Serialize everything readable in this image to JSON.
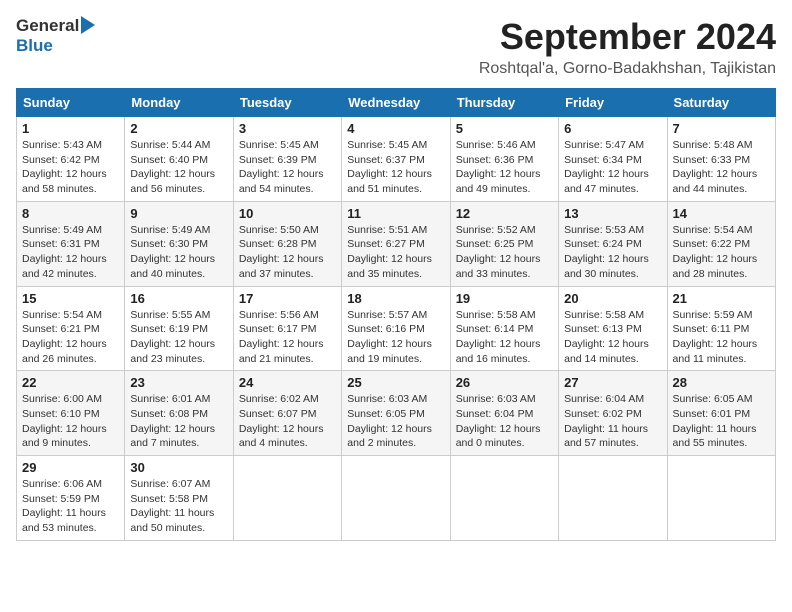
{
  "header": {
    "logo_general": "General",
    "logo_blue": "Blue",
    "month_title": "September 2024",
    "location": "Roshtqal'a, Gorno-Badakhshan, Tajikistan"
  },
  "days_of_week": [
    "Sunday",
    "Monday",
    "Tuesday",
    "Wednesday",
    "Thursday",
    "Friday",
    "Saturday"
  ],
  "weeks": [
    [
      {
        "day": "1",
        "sunrise": "Sunrise: 5:43 AM",
        "sunset": "Sunset: 6:42 PM",
        "daylight": "Daylight: 12 hours and 58 minutes."
      },
      {
        "day": "2",
        "sunrise": "Sunrise: 5:44 AM",
        "sunset": "Sunset: 6:40 PM",
        "daylight": "Daylight: 12 hours and 56 minutes."
      },
      {
        "day": "3",
        "sunrise": "Sunrise: 5:45 AM",
        "sunset": "Sunset: 6:39 PM",
        "daylight": "Daylight: 12 hours and 54 minutes."
      },
      {
        "day": "4",
        "sunrise": "Sunrise: 5:45 AM",
        "sunset": "Sunset: 6:37 PM",
        "daylight": "Daylight: 12 hours and 51 minutes."
      },
      {
        "day": "5",
        "sunrise": "Sunrise: 5:46 AM",
        "sunset": "Sunset: 6:36 PM",
        "daylight": "Daylight: 12 hours and 49 minutes."
      },
      {
        "day": "6",
        "sunrise": "Sunrise: 5:47 AM",
        "sunset": "Sunset: 6:34 PM",
        "daylight": "Daylight: 12 hours and 47 minutes."
      },
      {
        "day": "7",
        "sunrise": "Sunrise: 5:48 AM",
        "sunset": "Sunset: 6:33 PM",
        "daylight": "Daylight: 12 hours and 44 minutes."
      }
    ],
    [
      {
        "day": "8",
        "sunrise": "Sunrise: 5:49 AM",
        "sunset": "Sunset: 6:31 PM",
        "daylight": "Daylight: 12 hours and 42 minutes."
      },
      {
        "day": "9",
        "sunrise": "Sunrise: 5:49 AM",
        "sunset": "Sunset: 6:30 PM",
        "daylight": "Daylight: 12 hours and 40 minutes."
      },
      {
        "day": "10",
        "sunrise": "Sunrise: 5:50 AM",
        "sunset": "Sunset: 6:28 PM",
        "daylight": "Daylight: 12 hours and 37 minutes."
      },
      {
        "day": "11",
        "sunrise": "Sunrise: 5:51 AM",
        "sunset": "Sunset: 6:27 PM",
        "daylight": "Daylight: 12 hours and 35 minutes."
      },
      {
        "day": "12",
        "sunrise": "Sunrise: 5:52 AM",
        "sunset": "Sunset: 6:25 PM",
        "daylight": "Daylight: 12 hours and 33 minutes."
      },
      {
        "day": "13",
        "sunrise": "Sunrise: 5:53 AM",
        "sunset": "Sunset: 6:24 PM",
        "daylight": "Daylight: 12 hours and 30 minutes."
      },
      {
        "day": "14",
        "sunrise": "Sunrise: 5:54 AM",
        "sunset": "Sunset: 6:22 PM",
        "daylight": "Daylight: 12 hours and 28 minutes."
      }
    ],
    [
      {
        "day": "15",
        "sunrise": "Sunrise: 5:54 AM",
        "sunset": "Sunset: 6:21 PM",
        "daylight": "Daylight: 12 hours and 26 minutes."
      },
      {
        "day": "16",
        "sunrise": "Sunrise: 5:55 AM",
        "sunset": "Sunset: 6:19 PM",
        "daylight": "Daylight: 12 hours and 23 minutes."
      },
      {
        "day": "17",
        "sunrise": "Sunrise: 5:56 AM",
        "sunset": "Sunset: 6:17 PM",
        "daylight": "Daylight: 12 hours and 21 minutes."
      },
      {
        "day": "18",
        "sunrise": "Sunrise: 5:57 AM",
        "sunset": "Sunset: 6:16 PM",
        "daylight": "Daylight: 12 hours and 19 minutes."
      },
      {
        "day": "19",
        "sunrise": "Sunrise: 5:58 AM",
        "sunset": "Sunset: 6:14 PM",
        "daylight": "Daylight: 12 hours and 16 minutes."
      },
      {
        "day": "20",
        "sunrise": "Sunrise: 5:58 AM",
        "sunset": "Sunset: 6:13 PM",
        "daylight": "Daylight: 12 hours and 14 minutes."
      },
      {
        "day": "21",
        "sunrise": "Sunrise: 5:59 AM",
        "sunset": "Sunset: 6:11 PM",
        "daylight": "Daylight: 12 hours and 11 minutes."
      }
    ],
    [
      {
        "day": "22",
        "sunrise": "Sunrise: 6:00 AM",
        "sunset": "Sunset: 6:10 PM",
        "daylight": "Daylight: 12 hours and 9 minutes."
      },
      {
        "day": "23",
        "sunrise": "Sunrise: 6:01 AM",
        "sunset": "Sunset: 6:08 PM",
        "daylight": "Daylight: 12 hours and 7 minutes."
      },
      {
        "day": "24",
        "sunrise": "Sunrise: 6:02 AM",
        "sunset": "Sunset: 6:07 PM",
        "daylight": "Daylight: 12 hours and 4 minutes."
      },
      {
        "day": "25",
        "sunrise": "Sunrise: 6:03 AM",
        "sunset": "Sunset: 6:05 PM",
        "daylight": "Daylight: 12 hours and 2 minutes."
      },
      {
        "day": "26",
        "sunrise": "Sunrise: 6:03 AM",
        "sunset": "Sunset: 6:04 PM",
        "daylight": "Daylight: 12 hours and 0 minutes."
      },
      {
        "day": "27",
        "sunrise": "Sunrise: 6:04 AM",
        "sunset": "Sunset: 6:02 PM",
        "daylight": "Daylight: 11 hours and 57 minutes."
      },
      {
        "day": "28",
        "sunrise": "Sunrise: 6:05 AM",
        "sunset": "Sunset: 6:01 PM",
        "daylight": "Daylight: 11 hours and 55 minutes."
      }
    ],
    [
      {
        "day": "29",
        "sunrise": "Sunrise: 6:06 AM",
        "sunset": "Sunset: 5:59 PM",
        "daylight": "Daylight: 11 hours and 53 minutes."
      },
      {
        "day": "30",
        "sunrise": "Sunrise: 6:07 AM",
        "sunset": "Sunset: 5:58 PM",
        "daylight": "Daylight: 11 hours and 50 minutes."
      },
      null,
      null,
      null,
      null,
      null
    ]
  ]
}
